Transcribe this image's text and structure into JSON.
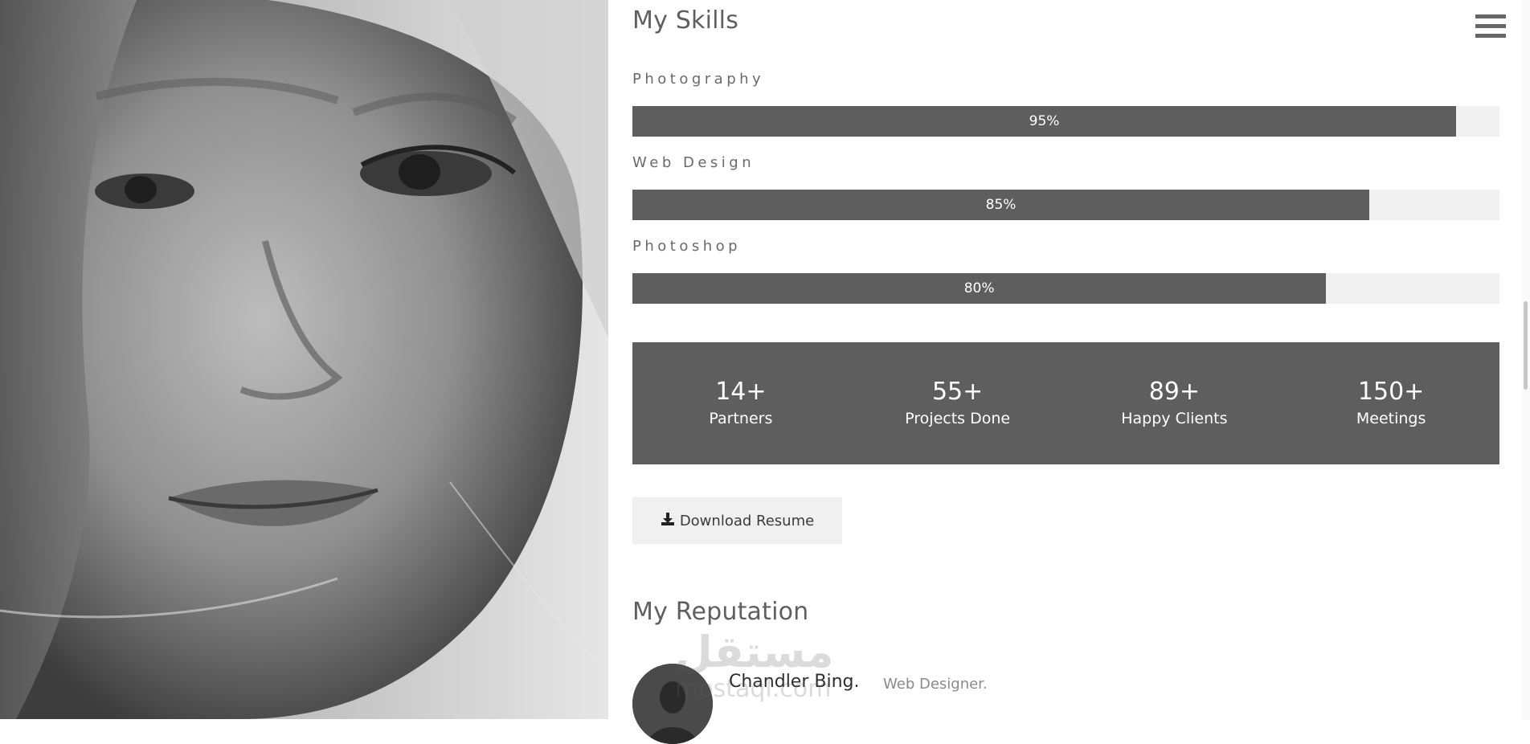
{
  "skills_section": {
    "title": "My Skills",
    "skills": [
      {
        "label": "Photography",
        "percent_text": "95%",
        "percent": 95
      },
      {
        "label": "Web Design",
        "percent_text": "85%",
        "percent": 85
      },
      {
        "label": "Photoshop",
        "percent_text": "80%",
        "percent": 80
      }
    ]
  },
  "stats": [
    {
      "number": "14+",
      "label": "Partners"
    },
    {
      "number": "55+",
      "label": "Projects Done"
    },
    {
      "number": "89+",
      "label": "Happy Clients"
    },
    {
      "number": "150+",
      "label": "Meetings"
    }
  ],
  "download": {
    "label": "Download Resume",
    "icon": "download-icon"
  },
  "reputation": {
    "title": "My Reputation",
    "reviews": [
      {
        "name": "Chandler Bing.",
        "role": "Web Designer."
      }
    ]
  },
  "watermark": {
    "arabic": "مستقل",
    "latin": "mostaql.com"
  },
  "menu": {
    "icon": "hamburger-menu-icon"
  },
  "colors": {
    "bar_fill": "#5e5e5e",
    "bar_track": "#f0f0f0",
    "stats_background": "#5e5e5e",
    "button_background": "#f0f0f0"
  }
}
